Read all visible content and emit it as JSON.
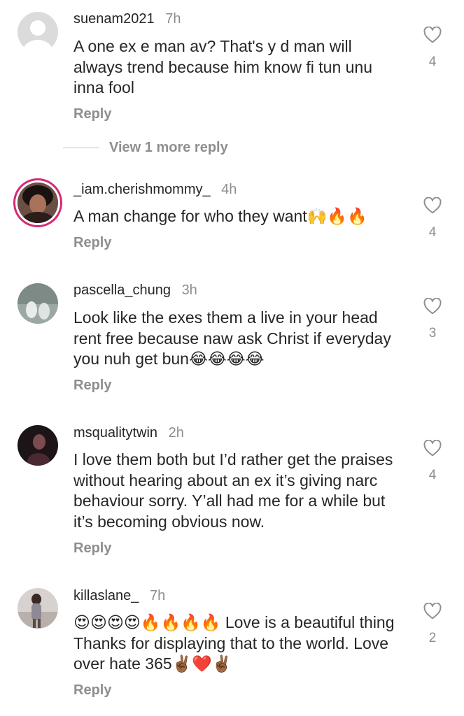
{
  "comments": [
    {
      "username": "suenam2021",
      "time": "7h",
      "text": "A one ex e man av? That's y d man will always trend because him know fi tun unu inna fool",
      "reply_label": "Reply",
      "likes": "4"
    },
    {
      "username": "_iam.cherishmommy_",
      "time": "4h",
      "text": "A man change for who they want🙌🔥🔥",
      "reply_label": "Reply",
      "likes": "4"
    },
    {
      "username": "pascella_chung",
      "time": "3h",
      "text": "Look like the exes them a live in your head rent free because naw ask Christ if everyday you nuh get bun😂😂😂😂",
      "reply_label": "Reply",
      "likes": "3"
    },
    {
      "username": "msqualitytwin",
      "time": "2h",
      "text": "I love them both but I’d rather get the praises without hearing about an ex it’s giving narc behaviour sorry. Y’all had me for a while but it’s becoming obvious now.",
      "reply_label": "Reply",
      "likes": "4"
    },
    {
      "username": "killaslane_",
      "time": "7h",
      "text": "😍😍😍😍🔥🔥🔥🔥 Love is a beautiful thing Thanks for displaying that to the world. Love over hate 365✌🏾❤️✌🏾",
      "reply_label": "Reply",
      "likes": "2"
    }
  ],
  "view_more_replies": "View 1 more reply",
  "icons": {
    "like": "heart-outline-icon"
  },
  "colors": {
    "text": "#262626",
    "secondary": "#8e8e8e",
    "story_ring": "#d62976"
  }
}
